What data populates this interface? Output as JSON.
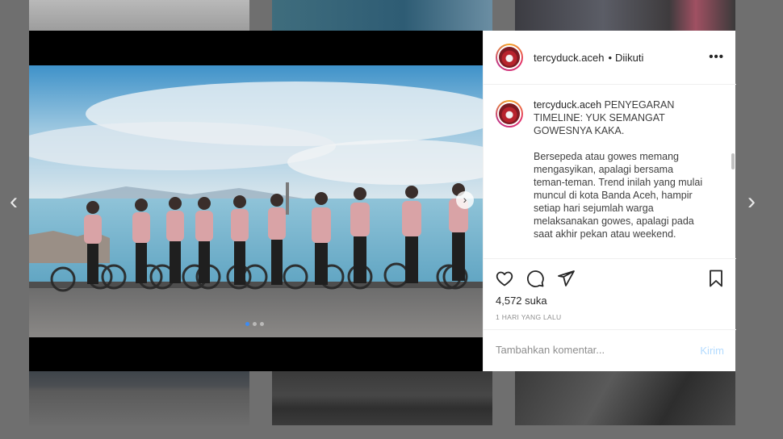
{
  "post": {
    "username": "tercyduck.aceh",
    "separator": "•",
    "follow_status": "Diikuti",
    "more_icon": "more-horizontal-icon",
    "caption_title": "PENYEGARAN\nTIMELINE: YUK SEMANGAT\nGOWESNYA KAKA.",
    "caption_body": "Bersepeda atau gowes memang\nmengasyikan, apalagi bersama\nteman-teman. Trend inilah yang mulai\nmuncul di kota Banda Aceh, hampir\nsetiap hari sejumlah warga\nmelaksanakan gowes, apalagi pada\nsaat akhir pekan atau weekend.",
    "likes": "4,572 suka",
    "time_ago": "1 HARI YANG LALU",
    "comment_placeholder": "Tambahkan komentar...",
    "post_button": "Kirim"
  },
  "carousel": {
    "total": 3,
    "active": 1
  },
  "icons": {
    "prev": "‹",
    "next": "›",
    "photo_next": "›",
    "like": "heart-icon",
    "comment": "comment-icon",
    "share": "paper-plane-icon",
    "save": "bookmark-icon"
  },
  "colors": {
    "accent_blue": "#3d8bf2",
    "post_button": "#b3dbff",
    "muted_text": "#8e8e8e"
  }
}
